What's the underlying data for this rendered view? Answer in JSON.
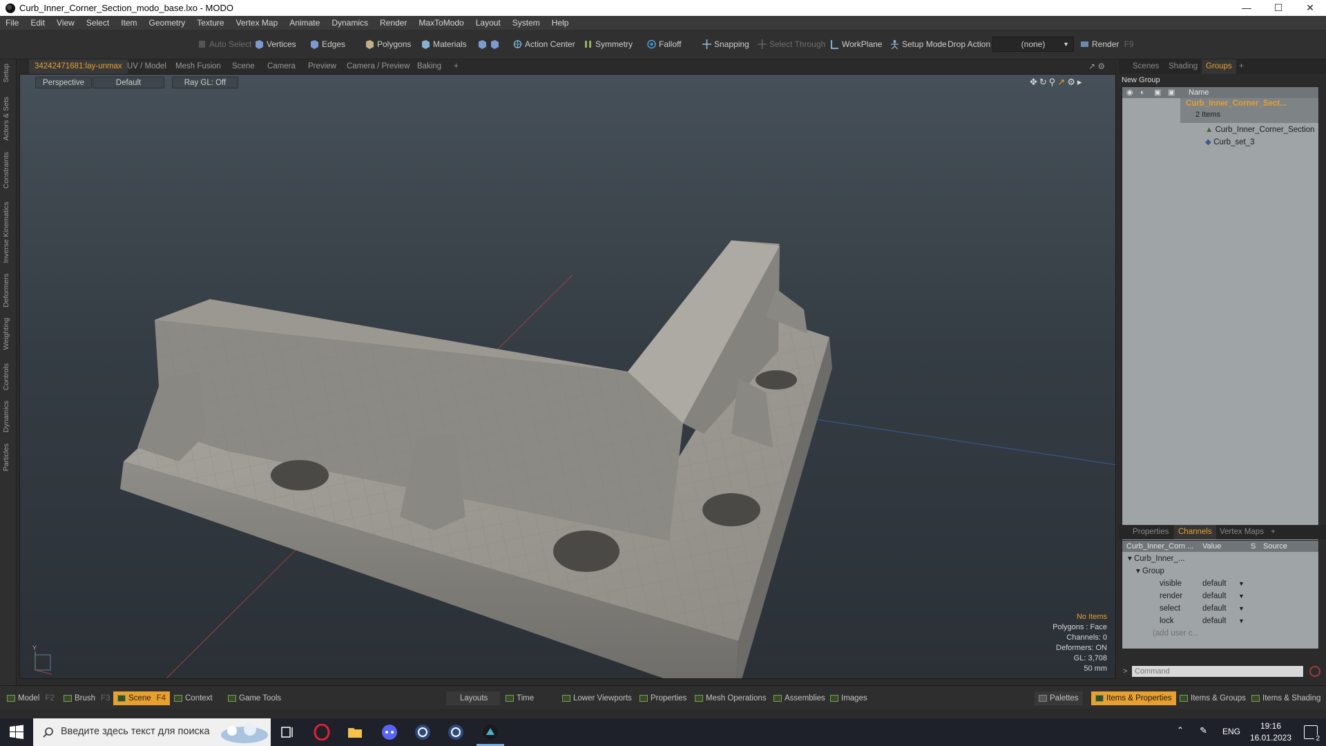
{
  "window": {
    "title": "Curb_Inner_Corner_Section_modo_base.lxo - MODO"
  },
  "menu": [
    "File",
    "Edit",
    "View",
    "Select",
    "Item",
    "Geometry",
    "Texture",
    "Vertex Map",
    "Animate",
    "Dynamics",
    "Render",
    "MaxToModo",
    "Layout",
    "System",
    "Help"
  ],
  "toolbar": {
    "auto_select": "Auto Select",
    "vertices": "Vertices",
    "edges": "Edges",
    "polygons": "Polygons",
    "materials": "Materials",
    "action_center": "Action Center",
    "symmetry": "Symmetry",
    "falloff": "Falloff",
    "snapping": "Snapping",
    "select_through": "Select Through",
    "workplane": "WorkPlane",
    "setup_mode": "Setup Mode",
    "drop_action": "Drop Action",
    "drop_action_value": "(none)",
    "render": "Render",
    "render_key": "F9"
  },
  "viewport_tabs": [
    "34242471681:lay-unmax",
    "UV / Model",
    "Mesh Fusion",
    "Scene",
    "Camera",
    "Preview",
    "Camera / Preview",
    "Baking",
    "+"
  ],
  "viewport": {
    "view": "Perspective",
    "style": "Default",
    "raygl": "Ray GL: Off",
    "info": {
      "no_items": "No Items",
      "polygons": "Polygons : Face",
      "channels": "Channels: 0",
      "deformers": "Deformers: ON",
      "gl": "GL: 3,708",
      "scale": "50 mm"
    }
  },
  "left_strip": [
    "Setup",
    "Actors & Sets",
    "Constraints",
    "Inverse Kinematics",
    "Deformers",
    "Weighting",
    "Controls",
    "Dynamics",
    "Particles"
  ],
  "groups_panel": {
    "tabs": [
      "Scenes",
      "Shading",
      "Groups",
      "+"
    ],
    "new_group": "New Group",
    "col_name": "Name",
    "items": [
      {
        "label": "Curb_Inner_Corner_Sect...",
        "sub": "2 Items"
      },
      {
        "label": "Curb_Inner_Corner_Section"
      },
      {
        "label": "Curb_set_3"
      }
    ]
  },
  "channels_panel": {
    "tabs": [
      "Properties",
      "Channels",
      "Vertex Maps",
      "+"
    ],
    "headers": [
      "Curb_Inner_Corn ...",
      "Value",
      "S",
      "Source"
    ],
    "root": "Curb_Inner_...",
    "group": "Group",
    "rows": [
      {
        "name": "visible",
        "value": "default"
      },
      {
        "name": "render",
        "value": "default"
      },
      {
        "name": "select",
        "value": "default"
      },
      {
        "name": "lock",
        "value": "default"
      }
    ],
    "add_user": "(add user c...",
    "command_placeholder": "Command"
  },
  "bottom_bar": {
    "model": "Model",
    "model_key": "F2",
    "brush": "Brush",
    "brush_key": "F3",
    "scene": "Scene",
    "scene_key": "F4",
    "context": "Context",
    "game_tools": "Game Tools",
    "layouts": "Layouts",
    "time": "Time",
    "lower_viewports": "Lower Viewports",
    "properties": "Properties",
    "mesh_operations": "Mesh Operations",
    "assemblies": "Assemblies",
    "images": "Images",
    "palettes": "Palettes",
    "items_properties": "Items & Properties",
    "items_groups": "Items & Groups",
    "items_shading": "Items & Shading"
  },
  "taskbar": {
    "search_placeholder": "Введите здесь текст для поиска",
    "lang": "ENG",
    "time": "19:16",
    "date": "16.01.2023",
    "notif_count": "2"
  },
  "colors": {
    "accent": "#e8a030",
    "viewport_top": "#465058",
    "viewport_bottom": "#2a3036"
  }
}
